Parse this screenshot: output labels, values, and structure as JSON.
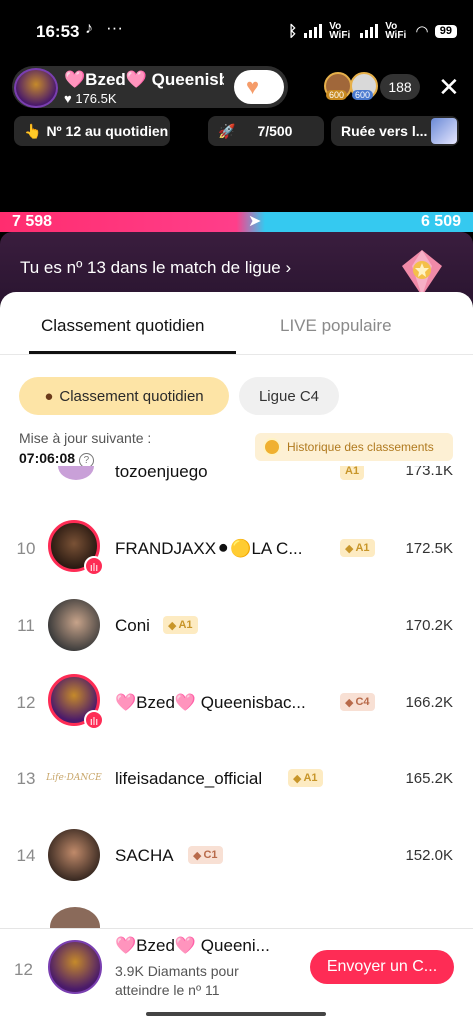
{
  "status_bar": {
    "time": "16:53",
    "network_1": "Vo WiFi",
    "network_2": "Vo WiFi",
    "battery": "99"
  },
  "host": {
    "name": "🩷Bzed🩷 Queenisbac...",
    "likes": "176.5K",
    "viewer_count": "188",
    "viewer_badges": [
      "600",
      "600"
    ]
  },
  "chips": {
    "daily_rank": "Nº 12 au quotidien",
    "goal": "7/500",
    "rush": "Ruée vers l..."
  },
  "battle": {
    "left_score": "7 598",
    "right_score": "6 509"
  },
  "league_banner": {
    "text": "Tu es nº 13 dans le match de ligue"
  },
  "tabs": [
    {
      "label": "Classement quotidien",
      "active": true
    },
    {
      "label": "LIVE populaire",
      "active": false
    }
  ],
  "filters": {
    "daily": "Classement quotidien",
    "league": "Ligue C4"
  },
  "update": {
    "label": "Mise à jour suivante :",
    "time": "07:06:08",
    "history": "Historique des classements"
  },
  "partial_row": {
    "name": "tozoenjuego",
    "level": "A1",
    "score": "173.1K"
  },
  "rows": [
    {
      "rank": "10",
      "name": "FRANDJAXX⚫🟡LA C...",
      "level": "A1",
      "score": "172.5K"
    },
    {
      "rank": "11",
      "name": "Coni",
      "level": "A1",
      "score": "170.2K"
    },
    {
      "rank": "12",
      "name": "🩷Bzed🩷 Queenisbac...",
      "level": "C4",
      "score": "166.2K"
    },
    {
      "rank": "13",
      "name": "lifeisadance_official",
      "level": "A1",
      "score": "165.2K"
    },
    {
      "rank": "14",
      "name": "SACHA",
      "level": "C1",
      "score": "152.0K"
    }
  ],
  "bottom_user": {
    "rank": "12",
    "name": "🩷Bzed🩷 Queeni...",
    "subtitle": "3.9K Diamants pour atteindre le nº 11",
    "button": "Envoyer un C..."
  },
  "colors": {
    "accent": "#fe2c55",
    "gold_chip": "#fde4a6",
    "battle_red": "#ff2d6f",
    "battle_blue": "#35c9f0"
  }
}
